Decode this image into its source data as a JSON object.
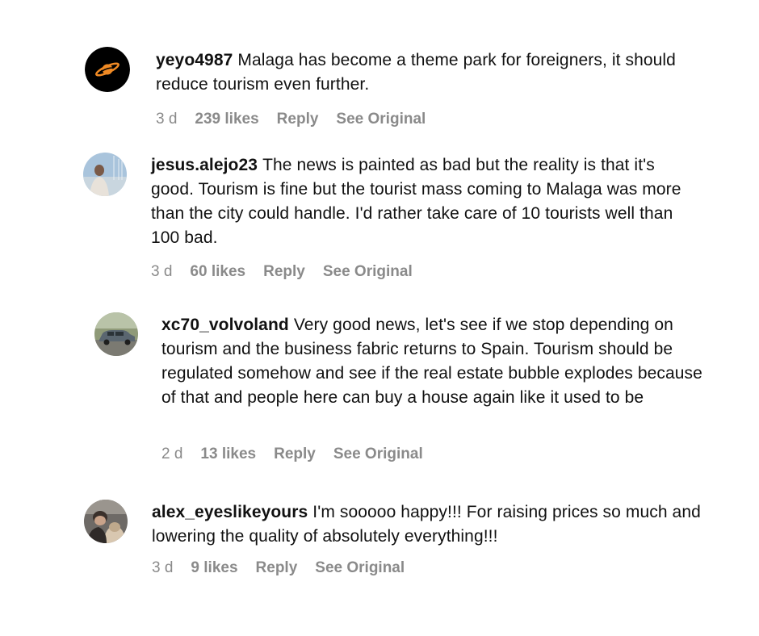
{
  "comments": [
    {
      "username": "yeyo4987",
      "text": "Malaga has become a theme park for foreigners, it should reduce tourism even further.",
      "time": "3 d",
      "likes": "239 likes",
      "reply_label": "Reply",
      "see_original_label": "See Original",
      "avatar_icon": "saturn-planet-icon"
    },
    {
      "username": "jesus.alejo23",
      "text": "The news is painted as bad but the reality is that it's good. Tourism is fine but the tourist mass coming to Malaga was more than the city could handle. I'd rather take care of 10 tourists well than 100 bad.",
      "time": "3 d",
      "likes": "60 likes",
      "reply_label": "Reply",
      "see_original_label": "See Original",
      "avatar_icon": "person-photo-avatar"
    },
    {
      "username": "xc70_volvoland",
      "text": "Very good news, let's see if we stop depending on tourism and the business fabric returns to Spain. Tourism should be regulated somehow and see if the real estate bubble explodes because of that and people here can buy a house again like it used to be",
      "time": "2 d",
      "likes": "13 likes",
      "reply_label": "Reply",
      "see_original_label": "See Original",
      "avatar_icon": "car-photo-avatar"
    },
    {
      "username": "alex_eyeslikeyours",
      "text": "I'm sooooo happy!!! For raising prices so much and lowering the quality of absolutely everything!!!",
      "time": "3 d",
      "likes": "9 likes",
      "reply_label": "Reply",
      "see_original_label": "See Original",
      "avatar_icon": "person-with-dog-photo-avatar"
    }
  ],
  "colors": {
    "text": "#111111",
    "meta": "#8a8a8a",
    "saturn_avatar_bg": "#000000",
    "saturn_accent": "#f08a24"
  }
}
